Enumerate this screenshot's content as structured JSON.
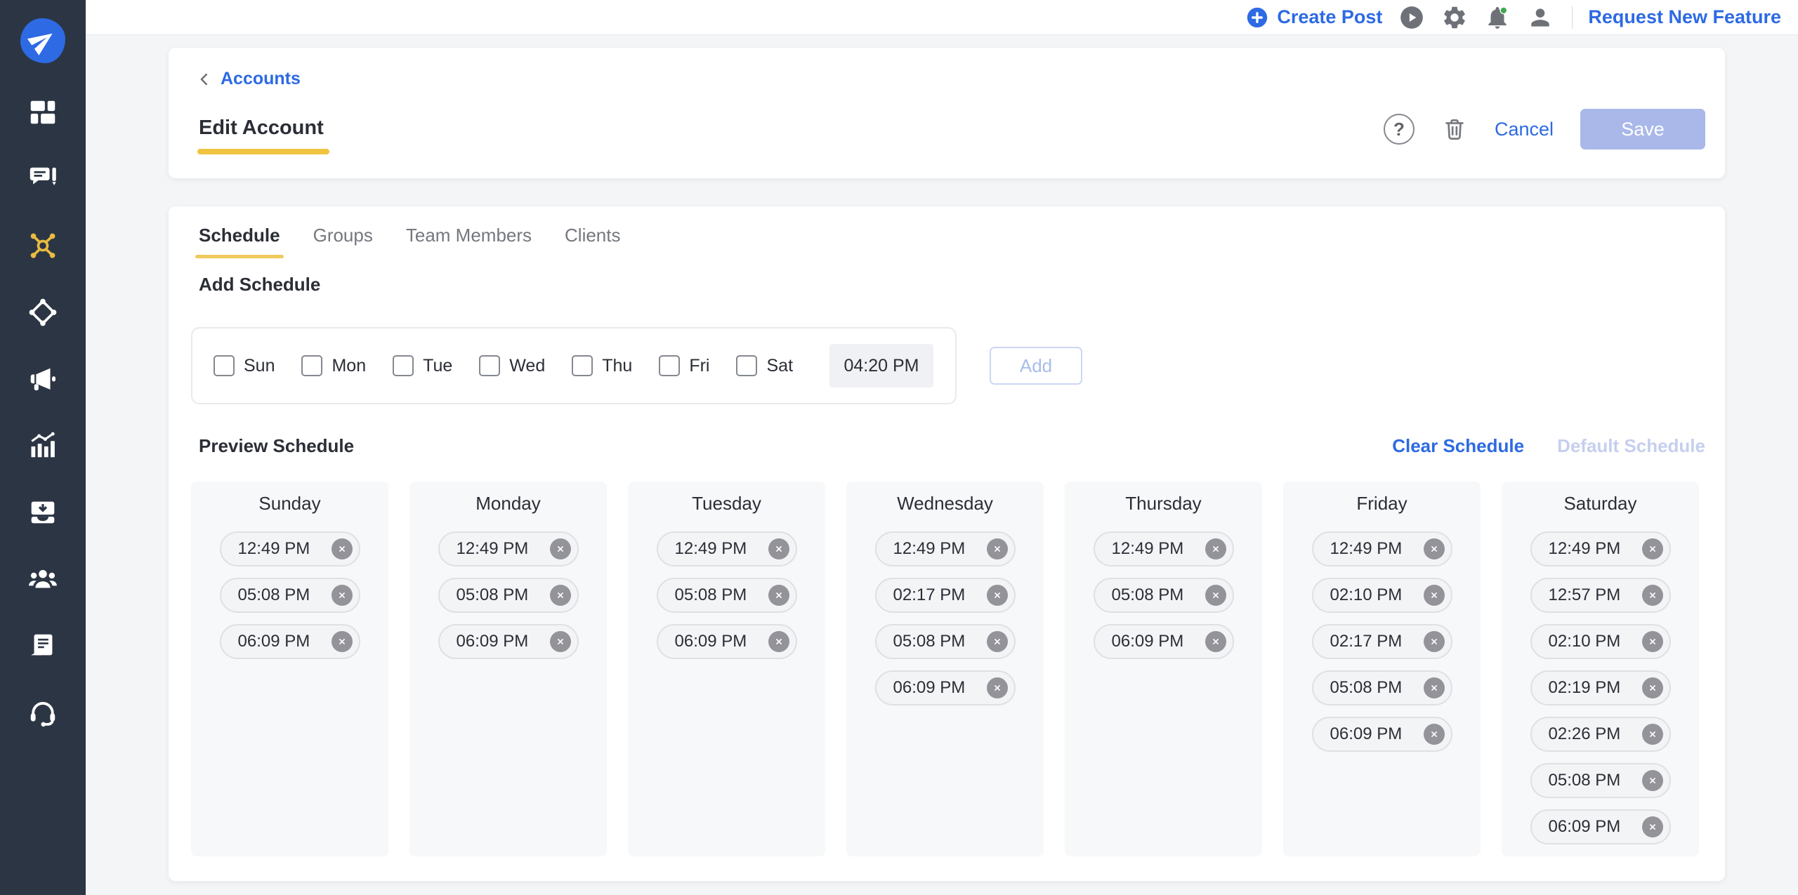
{
  "topbar": {
    "create_post_label": "Create Post",
    "request_feature_label": "Request New Feature"
  },
  "sidebar": {
    "items": [
      {
        "icon": "paper-plane-logo",
        "logo": true
      },
      {
        "icon": "dashboard-grid"
      },
      {
        "icon": "chat-pencil"
      },
      {
        "icon": "network-hub",
        "active": true
      },
      {
        "icon": "diamond-nodes"
      },
      {
        "icon": "megaphone"
      },
      {
        "icon": "bar-chart"
      },
      {
        "icon": "inbox-tray"
      },
      {
        "icon": "people-group"
      },
      {
        "icon": "document-stack"
      },
      {
        "icon": "headset"
      }
    ]
  },
  "header": {
    "breadcrumb_label": "Accounts",
    "title": "Edit Account",
    "help_label": "?",
    "cancel_label": "Cancel",
    "save_label": "Save"
  },
  "tabs": [
    {
      "label": "Schedule",
      "active": true
    },
    {
      "label": "Groups"
    },
    {
      "label": "Team Members"
    },
    {
      "label": "Clients"
    }
  ],
  "add_schedule": {
    "heading": "Add Schedule",
    "days": [
      "Sun",
      "Mon",
      "Tue",
      "Wed",
      "Thu",
      "Fri",
      "Sat"
    ],
    "time_value": "04:20 PM",
    "add_label": "Add"
  },
  "preview": {
    "heading": "Preview Schedule",
    "clear_label": "Clear Schedule",
    "default_label": "Default Schedule",
    "columns": [
      {
        "day": "Sunday",
        "times": [
          "12:49 PM",
          "05:08 PM",
          "06:09 PM"
        ]
      },
      {
        "day": "Monday",
        "times": [
          "12:49 PM",
          "05:08 PM",
          "06:09 PM"
        ]
      },
      {
        "day": "Tuesday",
        "times": [
          "12:49 PM",
          "05:08 PM",
          "06:09 PM"
        ]
      },
      {
        "day": "Wednesday",
        "times": [
          "12:49 PM",
          "02:17 PM",
          "05:08 PM",
          "06:09 PM"
        ]
      },
      {
        "day": "Thursday",
        "times": [
          "12:49 PM",
          "05:08 PM",
          "06:09 PM"
        ]
      },
      {
        "day": "Friday",
        "times": [
          "12:49 PM",
          "02:10 PM",
          "02:17 PM",
          "05:08 PM",
          "06:09 PM"
        ]
      },
      {
        "day": "Saturday",
        "times": [
          "12:49 PM",
          "12:57 PM",
          "02:10 PM",
          "02:19 PM",
          "02:26 PM",
          "05:08 PM",
          "06:09 PM"
        ]
      }
    ]
  },
  "colors": {
    "accent_blue": "#2d6ae3",
    "active_tab_underline": "#f0c440",
    "sidebar_background": "#2c3544",
    "sidebar_active_icon": "#e9bc40",
    "disabled_save_background": "#a9b8e9",
    "notification_dot_green": "#3fa94f"
  }
}
